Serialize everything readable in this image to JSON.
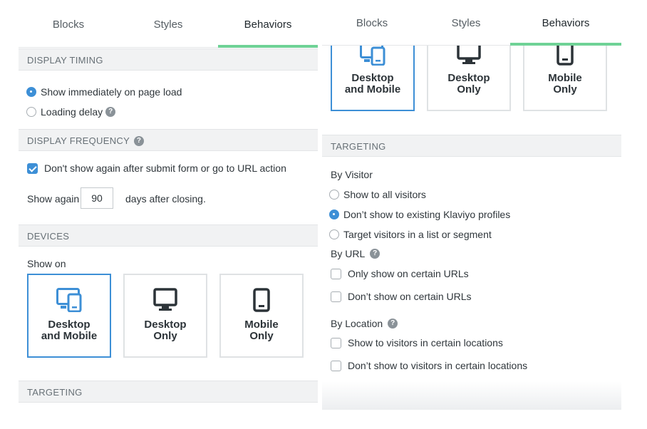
{
  "tabs": [
    "Blocks",
    "Styles",
    "Behaviors"
  ],
  "left": {
    "display_timing": {
      "header": "DISPLAY TIMING",
      "options": [
        "Show immediately on page load",
        "Loading delay"
      ]
    },
    "display_frequency": {
      "header": "DISPLAY FREQUENCY",
      "checkbox": "Don't show again after submit form or go to URL action",
      "show_again_label": "Show again",
      "days_value": "90",
      "days_suffix": "days after closing."
    },
    "devices": {
      "header": "DEVICES",
      "show_on": "Show on",
      "cards": [
        {
          "line1": "Desktop",
          "line2": "and Mobile",
          "icon": "desktop-mobile-icon"
        },
        {
          "line1": "Desktop",
          "line2": "Only",
          "icon": "desktop-icon"
        },
        {
          "line1": "Mobile",
          "line2": "Only",
          "icon": "mobile-icon"
        }
      ]
    },
    "targeting_header": "TARGETING"
  },
  "right": {
    "targeting": {
      "header": "TARGETING",
      "by_visitor": "By Visitor",
      "visitor_options": [
        "Show to all visitors",
        "Don’t show to existing Klaviyo profiles",
        "Target visitors in a list or segment"
      ],
      "by_url": "By URL",
      "url_options": [
        "Only show on certain URLs",
        "Don’t show on certain URLs"
      ],
      "by_location": "By Location",
      "location_options": [
        "Show to visitors in certain locations",
        "Don’t show to visitors in certain locations"
      ]
    }
  },
  "colors": {
    "accent": "#3d8fd6",
    "tab_underline": "#6fd296",
    "section_bg": "#f1f2f3"
  }
}
